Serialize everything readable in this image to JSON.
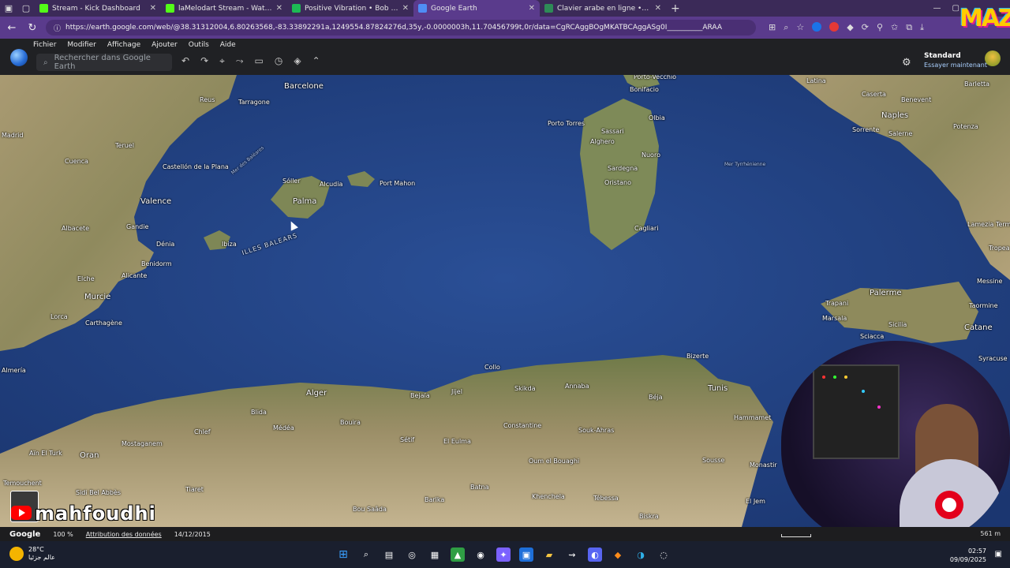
{
  "browser": {
    "tabs": [
      {
        "title": "Stream - Kick Dashboard",
        "favicon": "kick-icon",
        "color": "#53fc18",
        "active": false
      },
      {
        "title": "laMelodart Stream - Watch Live o",
        "favicon": "kick-icon",
        "color": "#53fc18",
        "active": false
      },
      {
        "title": "Positive Vibration • Bob Mar",
        "favicon": "spotify-icon",
        "color": "#1db954",
        "active": false
      },
      {
        "title": "Google Earth",
        "favicon": "earth-icon",
        "color": "#4f8df5",
        "active": true
      },
      {
        "title": "Clavier arabe en ligne • Lexilogos",
        "favicon": "lexilogos-icon",
        "color": "#2e8b57",
        "active": false
      }
    ],
    "url": "https://earth.google.com/web/@38.31312004,6.80263568,-83.33892291a,1249554.87824276d,35y,-0.0000003h,11.70456799t,0r/data=CgRCAggBOgMKATBCAggASg0I__________ARAA"
  },
  "earth": {
    "menu": [
      "Fichier",
      "Modifier",
      "Affichage",
      "Ajouter",
      "Outils",
      "Aide"
    ],
    "search_placeholder": "Rechercher dans Google Earth",
    "account": {
      "title": "Standard",
      "subtitle": "Essayer maintenant"
    },
    "status": {
      "brand": "Google",
      "zoom": "100 %",
      "attribution": "Attribution des données",
      "date": "14/12/2015",
      "altitude": "561 m"
    }
  },
  "map_labels": [
    {
      "text": "Barcelone",
      "cls": "big"
    },
    {
      "text": "Reus",
      "cls": ""
    },
    {
      "text": "Tarragone",
      "cls": ""
    },
    {
      "text": "Madrid",
      "cls": ""
    },
    {
      "text": "Teruel",
      "cls": ""
    },
    {
      "text": "Cuenca",
      "cls": ""
    },
    {
      "text": "Castellón de la Plana",
      "cls": ""
    },
    {
      "text": "Valence",
      "cls": "big"
    },
    {
      "text": "Albacete",
      "cls": ""
    },
    {
      "text": "Gandie",
      "cls": ""
    },
    {
      "text": "Dénia",
      "cls": ""
    },
    {
      "text": "Benidorm",
      "cls": ""
    },
    {
      "text": "Alicante",
      "cls": ""
    },
    {
      "text": "Elche",
      "cls": ""
    },
    {
      "text": "Murcie",
      "cls": "big"
    },
    {
      "text": "Lorca",
      "cls": ""
    },
    {
      "text": "Carthagène",
      "cls": ""
    },
    {
      "text": "Almería",
      "cls": ""
    },
    {
      "text": "Sóller",
      "cls": ""
    },
    {
      "text": "Alcudia",
      "cls": ""
    },
    {
      "text": "Palma",
      "cls": "big"
    },
    {
      "text": "Port Mahon",
      "cls": ""
    },
    {
      "text": "Ibiza",
      "cls": ""
    },
    {
      "text": "ILLES BALEARS",
      "cls": "sea-lg"
    },
    {
      "text": "Mer des Baléares",
      "cls": "sea"
    },
    {
      "text": "Porto-Vecchio",
      "cls": ""
    },
    {
      "text": "Bonifacio",
      "cls": ""
    },
    {
      "text": "Porto Torres",
      "cls": ""
    },
    {
      "text": "Sassari",
      "cls": ""
    },
    {
      "text": "Olbia",
      "cls": ""
    },
    {
      "text": "Alghero",
      "cls": ""
    },
    {
      "text": "Sardegna",
      "cls": ""
    },
    {
      "text": "Nuoro",
      "cls": ""
    },
    {
      "text": "Oristano",
      "cls": ""
    },
    {
      "text": "Cagliari",
      "cls": ""
    },
    {
      "text": "Mer Tyrrhénienne",
      "cls": "sea"
    },
    {
      "text": "Latina",
      "cls": ""
    },
    {
      "text": "Caserta",
      "cls": ""
    },
    {
      "text": "Benevent",
      "cls": ""
    },
    {
      "text": "Barletta",
      "cls": ""
    },
    {
      "text": "Naples",
      "cls": "big"
    },
    {
      "text": "Sorrente",
      "cls": ""
    },
    {
      "text": "Salerne",
      "cls": ""
    },
    {
      "text": "Potenza",
      "cls": ""
    },
    {
      "text": "Lamezia Terme",
      "cls": ""
    },
    {
      "text": "Tropea",
      "cls": ""
    },
    {
      "text": "Messine",
      "cls": ""
    },
    {
      "text": "Palerme",
      "cls": "big"
    },
    {
      "text": "Trapani",
      "cls": ""
    },
    {
      "text": "Marsala",
      "cls": ""
    },
    {
      "text": "Sicilia",
      "cls": ""
    },
    {
      "text": "Taormine",
      "cls": ""
    },
    {
      "text": "Catane",
      "cls": "big"
    },
    {
      "text": "Sciacca",
      "cls": ""
    },
    {
      "text": "Syracuse",
      "cls": ""
    },
    {
      "text": "Collo",
      "cls": ""
    },
    {
      "text": "Bizerte",
      "cls": ""
    },
    {
      "text": "Tunis",
      "cls": "big"
    },
    {
      "text": "Hammamet",
      "cls": ""
    },
    {
      "text": "Sousse",
      "cls": ""
    },
    {
      "text": "Monastir",
      "cls": ""
    },
    {
      "text": "El Jem",
      "cls": ""
    },
    {
      "text": "Alger",
      "cls": "big"
    },
    {
      "text": "Blida",
      "cls": ""
    },
    {
      "text": "Médéa",
      "cls": ""
    },
    {
      "text": "Bejaïa",
      "cls": ""
    },
    {
      "text": "Jijel",
      "cls": ""
    },
    {
      "text": "Skikda",
      "cls": ""
    },
    {
      "text": "Annaba",
      "cls": ""
    },
    {
      "text": "Constantine",
      "cls": ""
    },
    {
      "text": "Sétif",
      "cls": ""
    },
    {
      "text": "El Eulma",
      "cls": ""
    },
    {
      "text": "Bouira",
      "cls": ""
    },
    {
      "text": "Chlef",
      "cls": ""
    },
    {
      "text": "Mostaganem",
      "cls": ""
    },
    {
      "text": "Oran",
      "cls": "big"
    },
    {
      "text": "Aïn El Turk",
      "cls": ""
    },
    {
      "text": "Sidi Bel Abbès",
      "cls": ""
    },
    {
      "text": "Tiaret",
      "cls": ""
    },
    {
      "text": "Temouchent",
      "cls": ""
    },
    {
      "text": "Oum el Bouaghi",
      "cls": ""
    },
    {
      "text": "Souk-Ahras",
      "cls": ""
    },
    {
      "text": "Béja",
      "cls": ""
    },
    {
      "text": "Batna",
      "cls": ""
    },
    {
      "text": "Khenchela",
      "cls": ""
    },
    {
      "text": "Tébessa",
      "cls": ""
    },
    {
      "text": "Bou Saâda",
      "cls": ""
    },
    {
      "text": "Barika",
      "cls": ""
    },
    {
      "text": "Biskra",
      "cls": ""
    }
  ],
  "overlay": {
    "channel": "mahfoudhi",
    "logo": "MAZ"
  },
  "taskbar": {
    "weather_temp": "28°C",
    "weather_desc": "عالم جزئيا",
    "time": "02:57",
    "date": "09/09/2025"
  }
}
